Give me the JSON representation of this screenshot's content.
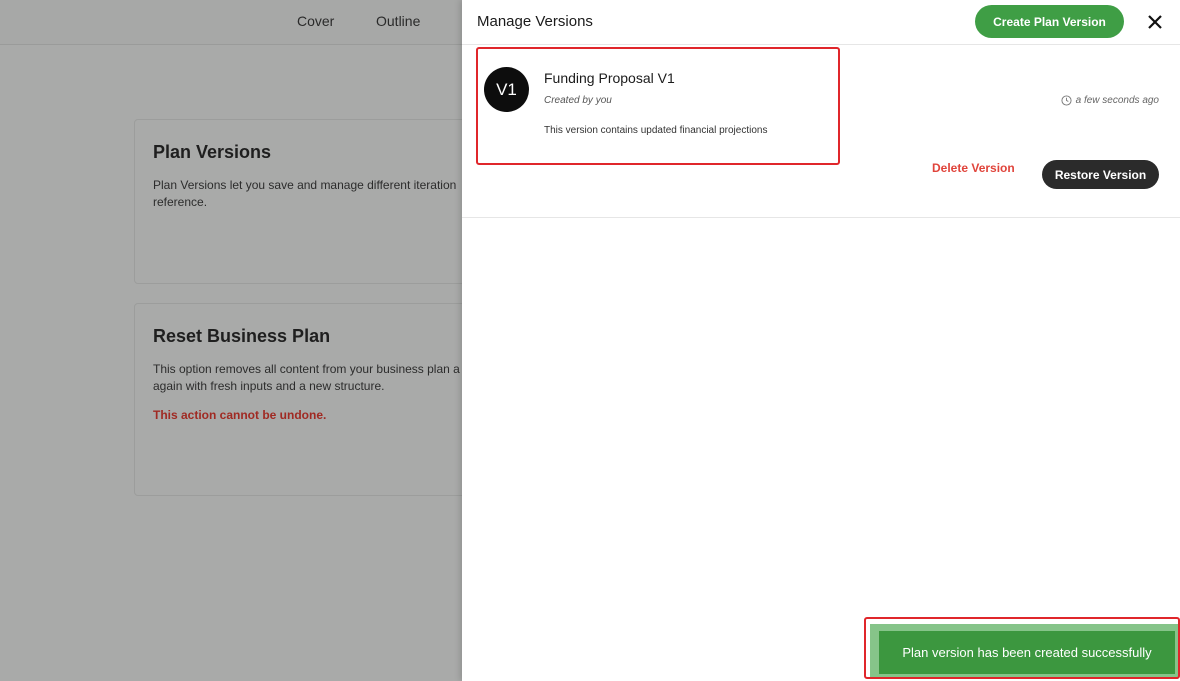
{
  "background": {
    "tabs": [
      "Cover",
      "Outline"
    ],
    "plan_versions_card": {
      "title": "Plan Versions",
      "text": "Plan Versions let you save and manage different iteration",
      "text2": "reference."
    },
    "reset_card": {
      "title": "Reset Business Plan",
      "text": "This option removes all content from your business plan a",
      "text2": "again with fresh inputs and a new structure.",
      "warning": "This action cannot be undone."
    }
  },
  "drawer": {
    "title": "Manage Versions",
    "create_label": "Create Plan Version",
    "close_icon": "close-icon"
  },
  "version": {
    "avatar": "V1",
    "name": "Funding Proposal V1",
    "created_by": "Created by you",
    "description": "This version contains updated financial projections",
    "time": "a few seconds ago",
    "delete_label": "Delete Version",
    "restore_label": "Restore Version"
  },
  "toast": {
    "message": "Plan version has been created successfully"
  },
  "colors": {
    "accent_green": "#3f9e45",
    "danger_red": "#e0443b",
    "highlight_red": "#e0262b"
  }
}
